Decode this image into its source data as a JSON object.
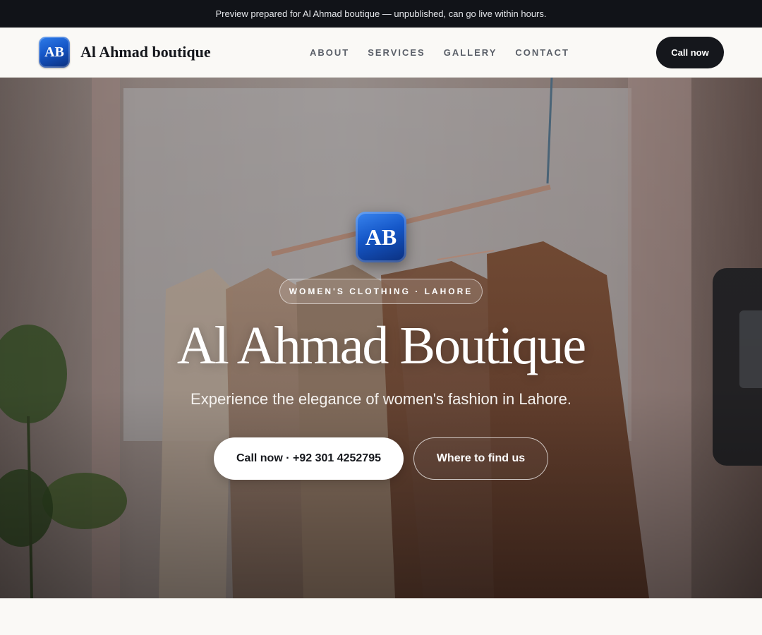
{
  "preview_banner": {
    "text": "Preview prepared for Al Ahmad boutique — unpublished, can go live within hours."
  },
  "header": {
    "logo_text": "AB",
    "brand_name": "Al Ahmad boutique",
    "nav": [
      {
        "label": "ABOUT"
      },
      {
        "label": "SERVICES"
      },
      {
        "label": "GALLERY"
      },
      {
        "label": "CONTACT"
      }
    ],
    "cta_label": "Call now"
  },
  "hero": {
    "logo_text": "AB",
    "tagline": "WOMEN'S CLOTHING · LAHORE",
    "title": "Al Ahmad Boutique",
    "subtitle": "Experience the elegance of women's fashion in Lahore.",
    "primary_button": "Call now · +92 301 4252795",
    "secondary_button": "Where to find us"
  },
  "colors": {
    "preview_bar_bg": "#111318",
    "header_bg": "#faf9f6",
    "brand_dark": "#15171c",
    "logo_blue": "#1557c8",
    "hero_overlay": "#6b5a55"
  }
}
